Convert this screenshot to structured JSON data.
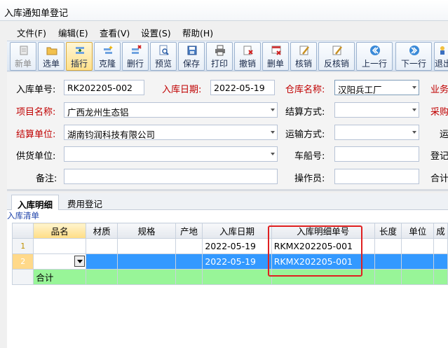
{
  "window": {
    "title": "入库通知单登记"
  },
  "menu": [
    "文件(F)",
    "编辑(E)",
    "查看(V)",
    "设置(S)",
    "帮助(H)"
  ],
  "toolbar": [
    {
      "label": "新单",
      "icon": "new-doc-icon",
      "disabled": true
    },
    {
      "label": "选单",
      "icon": "folder-icon"
    },
    {
      "label": "插行",
      "icon": "insert-row-icon",
      "active": true
    },
    {
      "label": "克隆",
      "icon": "clone-icon"
    },
    {
      "label": "删行",
      "icon": "delete-row-icon"
    },
    {
      "label": "预览",
      "icon": "preview-icon"
    },
    {
      "label": "保存",
      "icon": "save-icon"
    },
    {
      "label": "打印",
      "icon": "print-icon"
    },
    {
      "label": "撤销",
      "icon": "undo-icon"
    },
    {
      "label": "删单",
      "icon": "delete-doc-icon"
    },
    {
      "label": "核销",
      "icon": "verify-icon"
    },
    {
      "label": "反核销",
      "icon": "unverify-icon"
    },
    {
      "label": "上一行",
      "icon": "prev-icon"
    },
    {
      "label": "下一行",
      "icon": "next-icon"
    },
    {
      "label": "退出",
      "icon": "exit-icon"
    }
  ],
  "form": {
    "in_no_label": "入库单号:",
    "in_no": "RK202205-002",
    "in_date_label": "入库日期:",
    "in_date": "2022-05-19",
    "warehouse_label": "仓库名称:",
    "warehouse": "汉阳兵工厂",
    "business_label": "业务",
    "project_label": "项目名称:",
    "project": "广西龙州生态铝",
    "settle_method_label": "结算方式:",
    "settle_method": "",
    "purchase_label": "采购",
    "settle_unit_label": "结算单位:",
    "settle_unit": "湖南钧润科技有限公司",
    "transport_label": "运输方式:",
    "transport": "",
    "transport2_label": "运",
    "supplier_label": "供货单位:",
    "supplier": "",
    "car_no_label": "车船号:",
    "car_no": "",
    "register_label": "登记",
    "remark_label": "备注:",
    "remark": "",
    "operator_label": "操作员:",
    "operator": "",
    "total_label": "合计"
  },
  "tabs": [
    "入库明细",
    "费用登记"
  ],
  "grid": {
    "title": "入库清单",
    "columns": [
      "品名",
      "材质",
      "规格",
      "产地",
      "入库日期",
      "入库明细单号",
      "长度",
      "单位",
      "成"
    ],
    "rows": [
      {
        "no": "1",
        "date": "2022-05-19",
        "detail_no": "RKMX202205-001"
      },
      {
        "no": "2",
        "date": "2022-05-19",
        "detail_no": "RKMX202205-001"
      }
    ],
    "total_label": "合计"
  }
}
